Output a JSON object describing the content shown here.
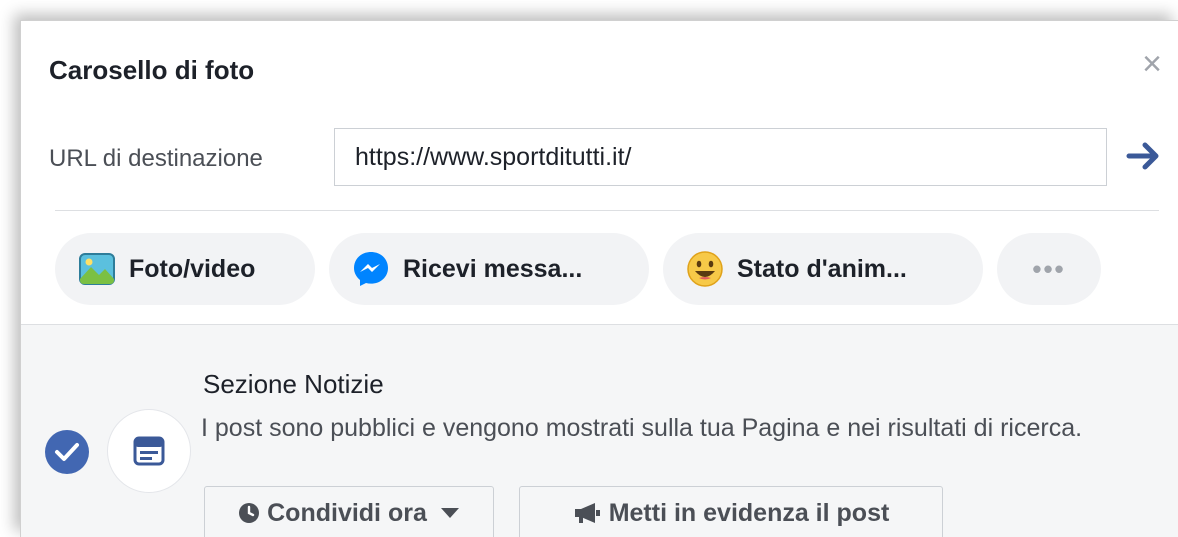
{
  "dialog": {
    "title": "Carosello di foto",
    "close_glyph": "×"
  },
  "url": {
    "label": "URL di destinazione",
    "value": "https://www.sportditutti.it/",
    "submit_icon": "arrow-right-icon"
  },
  "actions": [
    {
      "label": "Foto/video",
      "icon": "photo-icon"
    },
    {
      "label": "Ricevi messa...",
      "icon": "messenger-icon"
    },
    {
      "label": "Stato d'anim...",
      "icon": "smiley-icon"
    },
    {
      "label": "•••",
      "icon": "more-icon"
    }
  ],
  "placement": {
    "title": "Sezione Notizie",
    "description": "I post sono pubblici e vengono mostrati sulla tua Pagina e nei risultati di ricerca.",
    "checked": true
  },
  "buttons": {
    "share_label": "Condividi ora",
    "boost_label": "Metti in evidenza il post"
  },
  "colors": {
    "accent": "#4267b2",
    "arrow": "#3b5998",
    "pill_bg": "#f2f3f5"
  }
}
